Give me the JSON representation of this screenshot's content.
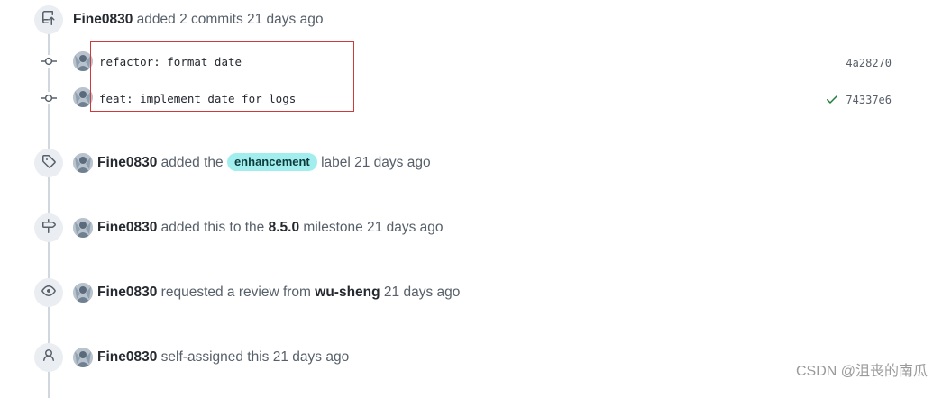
{
  "events": {
    "commits": {
      "author": "Fine0830",
      "text": "added 2 commits 21 days ago",
      "icon": "repo-push-icon"
    },
    "commit_list": [
      {
        "message": "refactor: format date",
        "sha": "4a28270",
        "status": ""
      },
      {
        "message": "feat: implement date for logs",
        "sha": "74337e6",
        "status": "check-icon"
      }
    ],
    "label": {
      "author": "Fine0830",
      "before": "added the",
      "label_name": "enhancement",
      "label_color": "#a2eeef",
      "after": "label 21 days ago",
      "icon": "tag-icon"
    },
    "milestone": {
      "author": "Fine0830",
      "before": "added this to the",
      "milestone_name": "8.5.0",
      "after": "milestone 21 days ago",
      "icon": "milestone-icon"
    },
    "review": {
      "author": "Fine0830",
      "before": "requested a review from",
      "reviewer": "wu-sheng",
      "after": "21 days ago",
      "icon": "eye-icon"
    },
    "assign": {
      "author": "Fine0830",
      "text": "self-assigned this 21 days ago",
      "icon": "person-icon"
    }
  },
  "watermark": "CSDN @沮丧的南瓜",
  "colors": {
    "accent_success": "#1a7f37",
    "highlight_border": "#d0393a",
    "timeline": "#d0d7de"
  }
}
